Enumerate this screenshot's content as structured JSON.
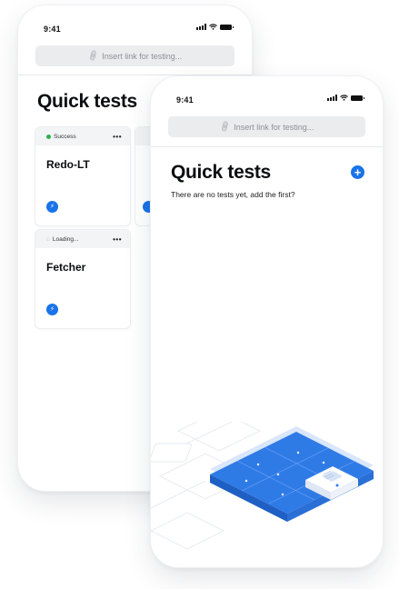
{
  "status_time": "9:41",
  "url_placeholder": "Insert link for testing...",
  "page_title": "Quick tests",
  "back_phone": {
    "cards": [
      {
        "status": "Success",
        "title": "Redo-LT"
      },
      {
        "status": "Loading...",
        "title": "Fetcher"
      }
    ]
  },
  "front_phone": {
    "empty_message": "There are no tests yet, add the first?"
  },
  "colors": {
    "accent": "#1a73e8",
    "success": "#2bb24c"
  },
  "icons": [
    "link-icon",
    "plus-icon",
    "menu-dots-icon",
    "bolt-icon",
    "signal-icon",
    "wifi-icon",
    "battery-icon"
  ]
}
